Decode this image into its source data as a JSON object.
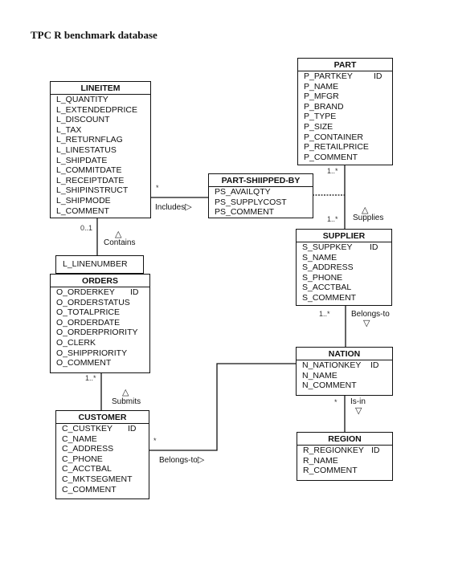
{
  "title": "TPC R benchmark database",
  "entities": {
    "lineitem": {
      "name": "LINEITEM",
      "attributes": [
        "L_QUANTITY",
        "L_EXTENDEDPRICE",
        "L_DISCOUNT",
        "L_TAX",
        "L_RETURNFLAG",
        "L_LINESTATUS",
        "L_SHIPDATE",
        "L_COMMITDATE",
        "L_RECEIPTDATE",
        "L_SHIPINSTRUCT",
        "L_SHIPMODE",
        "L_COMMENT"
      ]
    },
    "part": {
      "name": "PART",
      "attributes": [
        "P_PARTKEY",
        "P_NAME",
        "P_MFGR",
        "P_BRAND",
        "P_TYPE",
        "P_SIZE",
        "P_CONTAINER",
        "P_RETAILPRICE",
        "P_COMMENT"
      ],
      "id_marker": "ID"
    },
    "partsupp": {
      "name": "PART-SHIIPPED-BY",
      "attributes": [
        "PS_AVAILQTY",
        "PS_SUPPLYCOST",
        "PS_COMMENT"
      ]
    },
    "supplier": {
      "name": "SUPPLIER",
      "attributes": [
        "S_SUPPKEY",
        "S_NAME",
        "S_ADDRESS",
        "S_PHONE",
        "S_ACCTBAL",
        "S_COMMENT"
      ],
      "id_marker": "ID"
    },
    "orders": {
      "name": "ORDERS",
      "qualifier": "L_LINENUMBER",
      "attributes": [
        "O_ORDERKEY",
        "O_ORDERSTATUS",
        "O_TOTALPRICE",
        "O_ORDERDATE",
        "O_ORDERPRIORITY",
        "O_CLERK",
        "O_SHIPPRIORITY",
        "O_COMMENT"
      ],
      "id_marker": "ID"
    },
    "nation": {
      "name": "NATION",
      "attributes": [
        "N_NATIONKEY",
        "N_NAME",
        "N_COMMENT"
      ],
      "id_marker": "ID"
    },
    "customer": {
      "name": "CUSTOMER",
      "attributes": [
        "C_CUSTKEY",
        "C_NAME",
        "C_ADDRESS",
        "C_PHONE",
        "C_ACCTBAL",
        "C_MKTSEGMENT",
        "C_COMMENT"
      ],
      "id_marker": "ID"
    },
    "region": {
      "name": "REGION",
      "attributes": [
        "R_REGIONKEY",
        "R_NAME",
        "R_COMMENT"
      ],
      "id_marker": "ID"
    }
  },
  "relationships": {
    "includes": {
      "label": "Includes",
      "arrow": "▷",
      "mult_lineitem": "*"
    },
    "supplies": {
      "label": "Supplies",
      "arrow": "△",
      "mult_part": "1..*",
      "mult_supplier": "1..*"
    },
    "contains": {
      "label": "Contains",
      "arrow": "△",
      "mult_lineitem": "0..1"
    },
    "submits": {
      "label": "Submits",
      "arrow": "△",
      "mult_orders": "1..*"
    },
    "supplier_belongs_to": {
      "label": "Belongs-to",
      "arrow": "▽",
      "mult_supplier": "1..*"
    },
    "customer_belongs_to": {
      "label": "Belongs-to",
      "arrow": "▷",
      "mult_customer": "*"
    },
    "is_in": {
      "label": "Is-in",
      "arrow": "▽",
      "mult_nation": "*"
    }
  }
}
